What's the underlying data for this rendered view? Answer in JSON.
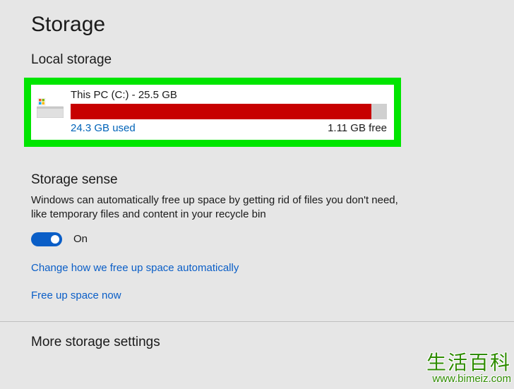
{
  "page": {
    "title": "Storage"
  },
  "localStorage": {
    "heading": "Local storage",
    "drive": {
      "title": "This PC (C:) - 25.5 GB",
      "used": "24.3 GB used",
      "free": "1.11 GB free",
      "fillPercent": "95%"
    }
  },
  "storageSense": {
    "heading": "Storage sense",
    "description": "Windows can automatically free up space by getting rid of files you don't need, like temporary files and content in your recycle bin",
    "toggleState": "On",
    "link1": "Change how we free up space automatically",
    "link2": "Free up space now"
  },
  "moreStorage": {
    "heading": "More storage settings"
  },
  "watermark": {
    "top": "生活百科",
    "bottom": "www.bimeiz.com"
  }
}
